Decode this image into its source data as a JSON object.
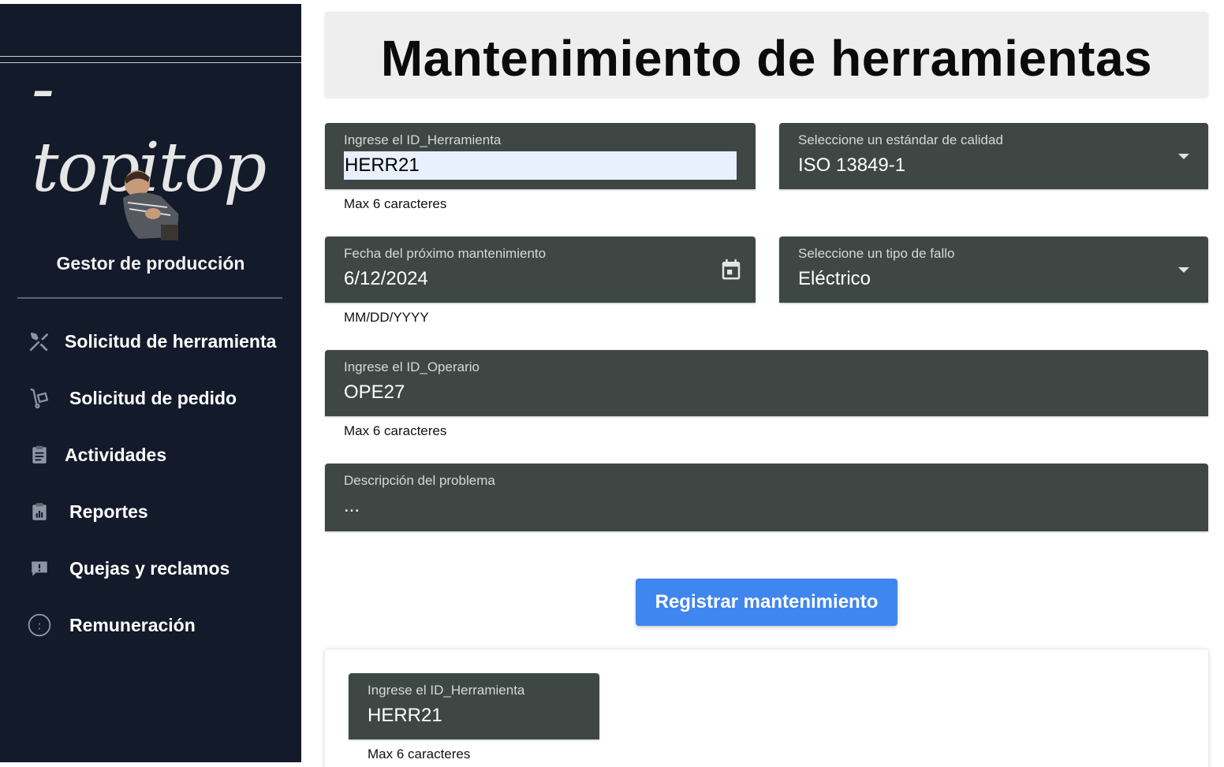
{
  "sidebar": {
    "logo_text": "-topitop",
    "role": "Gestor de producción",
    "items": [
      {
        "label": "Solicitud de herramienta",
        "icon": "tools-icon"
      },
      {
        "label": "Solicitud de pedido",
        "icon": "hand-truck-icon"
      },
      {
        "label": "Actividades",
        "icon": "clipboard-icon"
      },
      {
        "label": "Reportes",
        "icon": "report-icon"
      },
      {
        "label": "Quejas y reclamos",
        "icon": "feedback-icon"
      },
      {
        "label": "Remuneración",
        "icon": "money-circle-icon"
      }
    ]
  },
  "header": {
    "title": "Mantenimiento de herramientas"
  },
  "form": {
    "tool_id": {
      "label": "Ingrese el ID_Herramienta",
      "value": "HERR21",
      "helper": "Max 6 caracteres"
    },
    "quality_standard": {
      "label": "Seleccione un estándar de calidad",
      "value": "ISO 13849-1"
    },
    "next_maintenance": {
      "label": "Fecha del próximo mantenimiento",
      "value": "6/12/2024",
      "helper": "MM/DD/YYYY"
    },
    "failure_type": {
      "label": "Seleccione un tipo de fallo",
      "value": "Eléctrico"
    },
    "operator_id": {
      "label": "Ingrese el ID_Operario",
      "value": "OPE27",
      "helper": "Max 6 caracteres"
    },
    "description": {
      "label": "Descripción del problema",
      "value": "..."
    },
    "submit_label": "Registrar mantenimiento"
  },
  "card": {
    "tool_id": {
      "label": "Ingrese el ID_Herramienta",
      "value": "HERR21",
      "helper": "Max 6 caracteres"
    }
  },
  "colors": {
    "sidebar_bg": "#131a2a",
    "field_bg": "#3e4744",
    "primary_button": "#3f86f0",
    "autofill_bg": "#e8f0fe"
  }
}
